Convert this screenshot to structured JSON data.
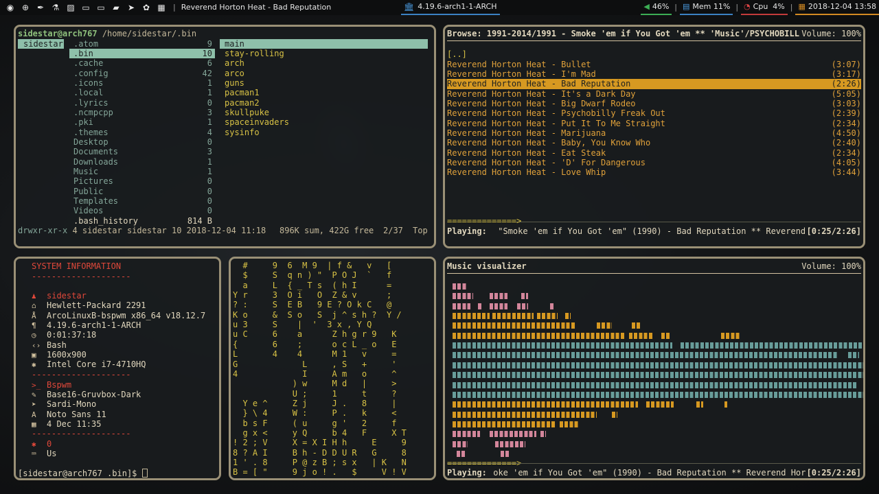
{
  "topbar": {
    "icons": [
      "arch-logo-icon",
      "globe-icon",
      "eyedropper-icon",
      "flask-icon",
      "image-icon",
      "terminal-icon",
      "monitor-icon",
      "folder-icon",
      "telegram-icon",
      "paw-icon",
      "grid-icon"
    ],
    "title": "Reverend Horton Heat - Bad Reputation",
    "kernel": "4.19.6-arch1-1-ARCH",
    "volume": "46%",
    "mem": "Mem 11%",
    "cpu_label": "Cpu",
    "cpu": "4%",
    "datetime": "2018-12-04 13:58"
  },
  "ranger": {
    "prompt_user": "sidestar@arch767",
    "prompt_path": "/home/sidestar/.bin",
    "parent": "sidestar",
    "entries": [
      {
        "name": ".atom",
        "count": "9"
      },
      {
        "name": ".bin",
        "count": "10"
      },
      {
        "name": ".cache",
        "count": "6"
      },
      {
        "name": ".config",
        "count": "42"
      },
      {
        "name": ".icons",
        "count": "1"
      },
      {
        "name": ".local",
        "count": "1"
      },
      {
        "name": ".lyrics",
        "count": "0"
      },
      {
        "name": ".ncmpcpp",
        "count": "3"
      },
      {
        "name": ".pki",
        "count": "1"
      },
      {
        "name": ".themes",
        "count": "4"
      },
      {
        "name": "Desktop",
        "count": "0"
      },
      {
        "name": "Documents",
        "count": "3"
      },
      {
        "name": "Downloads",
        "count": "1"
      },
      {
        "name": "Music",
        "count": "1"
      },
      {
        "name": "Pictures",
        "count": "0"
      },
      {
        "name": "Public",
        "count": "0"
      },
      {
        "name": "Templates",
        "count": "0"
      },
      {
        "name": "Videos",
        "count": "0"
      },
      {
        "name": ".bash_history",
        "count": "814 B"
      }
    ],
    "preview": [
      "main",
      "stay-rolling",
      "arch",
      "arco",
      "guns",
      "pacman1",
      "pacman2",
      "skullpuke",
      "spaceinvaders",
      "sysinfo"
    ],
    "status_perm": "drwxr-xr-x",
    "status_info": "4 sidestar sidestar 10 2018-12-04 11:18",
    "status_sum": "896K sum, 422G free",
    "status_pos": "2/37",
    "status_top": "Top"
  },
  "mpd": {
    "header": "Browse: 1991-2014/1991 - Smoke 'em if You Got 'em ** 'Music'/PSYCHOBILL",
    "volume": "Volume: 100%",
    "up": "[..]",
    "tracks": [
      {
        "title": "Reverend Horton Heat - Bullet",
        "time": "(3:07)"
      },
      {
        "title": "Reverend Horton Heat - I'm Mad",
        "time": "(3:17)"
      },
      {
        "title": "Reverend Horton Heat - Bad Reputation",
        "time": "(2:26)"
      },
      {
        "title": "Reverend Horton Heat - It's a Dark Day",
        "time": "(5:05)"
      },
      {
        "title": "Reverend Horton Heat - Big Dwarf Rodeo",
        "time": "(3:03)"
      },
      {
        "title": "Reverend Horton Heat - Psychobilly Freak Out",
        "time": "(2:39)"
      },
      {
        "title": "Reverend Horton Heat - Put It To Me Straight",
        "time": "(2:34)"
      },
      {
        "title": "Reverend Horton Heat - Marijuana",
        "time": "(4:50)"
      },
      {
        "title": "Reverend Horton Heat - Baby, You Know Who",
        "time": "(2:40)"
      },
      {
        "title": "Reverend Horton Heat - Eat Steak",
        "time": "(2:34)"
      },
      {
        "title": "Reverend Horton Heat - 'D' For Dangerous",
        "time": "(4:05)"
      },
      {
        "title": "Reverend Horton Heat - Love Whip",
        "time": "(3:44)"
      }
    ],
    "progress": "==============>",
    "playing_label": "Playing:",
    "playing_text": " \"Smoke 'em if You Got 'em\" (1990) - Bad Reputation ** Reverend",
    "playing_time": "[0:25/2:26]"
  },
  "sysinfo": {
    "title": "SYSTEM INFORMATION",
    "sep": "--------------------",
    "items_a": [
      {
        "icon": "user-icon",
        "glyph": "♟",
        "text": "sidestar",
        "color": "#e0483a"
      },
      {
        "icon": "bank-icon",
        "glyph": "⌂",
        "text": "Hewlett-Packard 2291",
        "color": "#e2d8be"
      },
      {
        "icon": "arch-icon",
        "glyph": "Å",
        "text": "ArcoLinuxB-bspwm x86_64 v18.12.7",
        "color": "#e2d8be"
      },
      {
        "icon": "paragraph-icon",
        "glyph": "¶",
        "text": "4.19.6-arch1-1-ARCH",
        "color": "#e2d8be"
      },
      {
        "icon": "clock-icon",
        "glyph": "◷",
        "text": "0:01:37:18",
        "color": "#e2d8be"
      },
      {
        "icon": "code-icon",
        "glyph": "‹›",
        "text": "Bash",
        "color": "#e2d8be"
      },
      {
        "icon": "image-icon",
        "glyph": "▣",
        "text": "1600x900",
        "color": "#e2d8be"
      },
      {
        "icon": "cpu-icon",
        "glyph": "✱",
        "text": "Intel Core i7-4710HQ",
        "color": "#e2d8be"
      }
    ],
    "items_b": [
      {
        "icon": "terminal-icon",
        "glyph": ">_",
        "text": "Bspwm",
        "color": "#e0483a"
      },
      {
        "icon": "paint-icon",
        "glyph": "✎",
        "text": "Base16-Gruvbox-Dark",
        "color": "#e2d8be"
      },
      {
        "icon": "cursor-icon",
        "glyph": "➤",
        "text": "Sardi-Mono",
        "color": "#e2d8be"
      },
      {
        "icon": "font-icon",
        "glyph": "A",
        "text": "Noto Sans 11",
        "color": "#e2d8be"
      },
      {
        "icon": "calendar-icon",
        "glyph": "▦",
        "text": "4 Dec 11:35",
        "color": "#e2d8be"
      }
    ],
    "items_c": [
      {
        "icon": "asterisk-icon",
        "glyph": "✱",
        "text": "0",
        "color": "#e0483a"
      },
      {
        "icon": "keyboard-icon",
        "glyph": "⌨",
        "text": "Us",
        "color": "#e2d8be"
      }
    ],
    "prompt": "[sidestar@arch767 .bin]$ "
  },
  "matrix": {
    "lines": [
      "  #     9  6  M 9  | f &   v   [",
      "  $     S  q n ) \"  P O J  `   f",
      "  a     L  { _ T s  ( h I      =",
      "Y r     3  O i   O  Z & v      ;",
      "? :     S  E B   9 E ? O k C   @",
      "K o     &  S o   S  j ^ s h ?  Y /",
      "u 3     S    |  '  3 x , Y Q",
      "u C     6    a      Z h g r 9   K",
      "{       6    ;      o c L _ o   E",
      "L       4    4      M 1   v     =",
      "G             L     , S   +     '",
      "4             I     A m   o     ^",
      "            ) w     M d   |     >",
      "            U ;     1     t     ?",
      "  Y e ^     Z j     J .   8     |",
      "  } \\ 4     W :     P .   k     <",
      "  b s F     ( u     g '   2     f",
      "  g x <     y Q     b 4   F     X T",
      "! 2 ; V     X = X I H h     E     9",
      "8 ? A I     B h - D D U R   G     8",
      "1 ' . 8     P @ z B ; s x   | K   N",
      "B = [ \"     9 j o ! .   $     V ! V"
    ]
  },
  "visualizer": {
    "title": "Music visualizer",
    "volume": "Volume: 100%",
    "progress": "==============>",
    "playing_label": "Playing:",
    "playing_text": " oke 'em if You Got 'em\" (1990) - Bad Reputation ** Reverend Hor",
    "playing_time": "[0:25/2:26]",
    "colors": {
      "pink": "#d3869b",
      "yellow": "#d79921",
      "teal": "#689d9a"
    }
  }
}
